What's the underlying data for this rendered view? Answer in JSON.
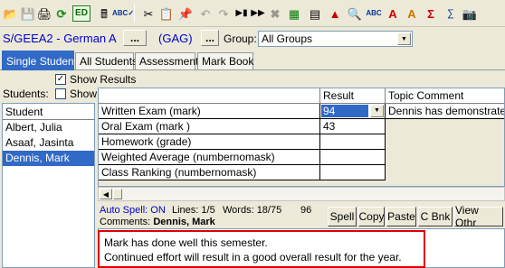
{
  "toolbar": {
    "icons": [
      "open-folder-icon",
      "save-disk-icon",
      "print-icon",
      "refresh-icon",
      "ed-icon",
      "calculator-icon",
      "spellcheck-icon",
      "cut-icon",
      "copy-icon",
      "paste-icon",
      "undo-icon",
      "redo-icon",
      "next-icon",
      "last-icon",
      "delete-icon",
      "grid-icon",
      "table-icon",
      "chart-icon",
      "preview-icon",
      "spelling-icon",
      "font-color-icon",
      "highlight-icon",
      "sigma-icon",
      "formula-icon",
      "camera-icon"
    ],
    "ed_label": "ED"
  },
  "class_bar": {
    "class_name": "S/GEEA2 - German A",
    "more_label": "...",
    "group_code": "(GAG)",
    "group_label": "Group:",
    "group_value": "All Groups"
  },
  "tabs": [
    {
      "label": "Single Student",
      "active": true
    },
    {
      "label": "All Students",
      "active": false
    },
    {
      "label": "Assessment",
      "active": false
    },
    {
      "label": "Mark Book",
      "active": false
    }
  ],
  "show_results": {
    "label": "Show Results",
    "checked": true
  },
  "students": {
    "label": "Students:",
    "show_label": "Show",
    "show_checked": false,
    "column_header": "Student",
    "items": [
      {
        "name": "Albert, Julia",
        "selected": false
      },
      {
        "name": "Asaaf, Jasinta",
        "selected": false
      },
      {
        "name": "Dennis, Mark",
        "selected": true
      }
    ]
  },
  "grid": {
    "headers": {
      "result": "Result",
      "topic_comment": "Topic Comment"
    },
    "rows": [
      {
        "task": "Written Exam (mark)",
        "result": "94",
        "comment": "Dennis has demonstrated an"
      },
      {
        "task": "Oral Exam (mark )",
        "result": "43",
        "comment": ""
      },
      {
        "task": "Homework (grade)",
        "result": "",
        "comment": ""
      },
      {
        "task": "Weighted Average (numbernomask)",
        "result": "",
        "comment": ""
      },
      {
        "task": "Class Ranking (numbernomask)",
        "result": "",
        "comment": ""
      }
    ]
  },
  "status": {
    "auto_spell": "Auto Spell: ON",
    "lines": "Lines: 1/5",
    "words": "Words: 18/75",
    "chars": "96",
    "comments_prefix": "Comments:",
    "comments_student": "Dennis, Mark"
  },
  "comment_buttons": {
    "spell": "Spell",
    "copy": "Copy",
    "paste": "Paste",
    "cbnk": "C Bnk",
    "view_other": "View Othr"
  },
  "comment_text": {
    "line1": "Mark has done well this semester.",
    "line2": "Continued effort will result in a good overall result for the year."
  }
}
